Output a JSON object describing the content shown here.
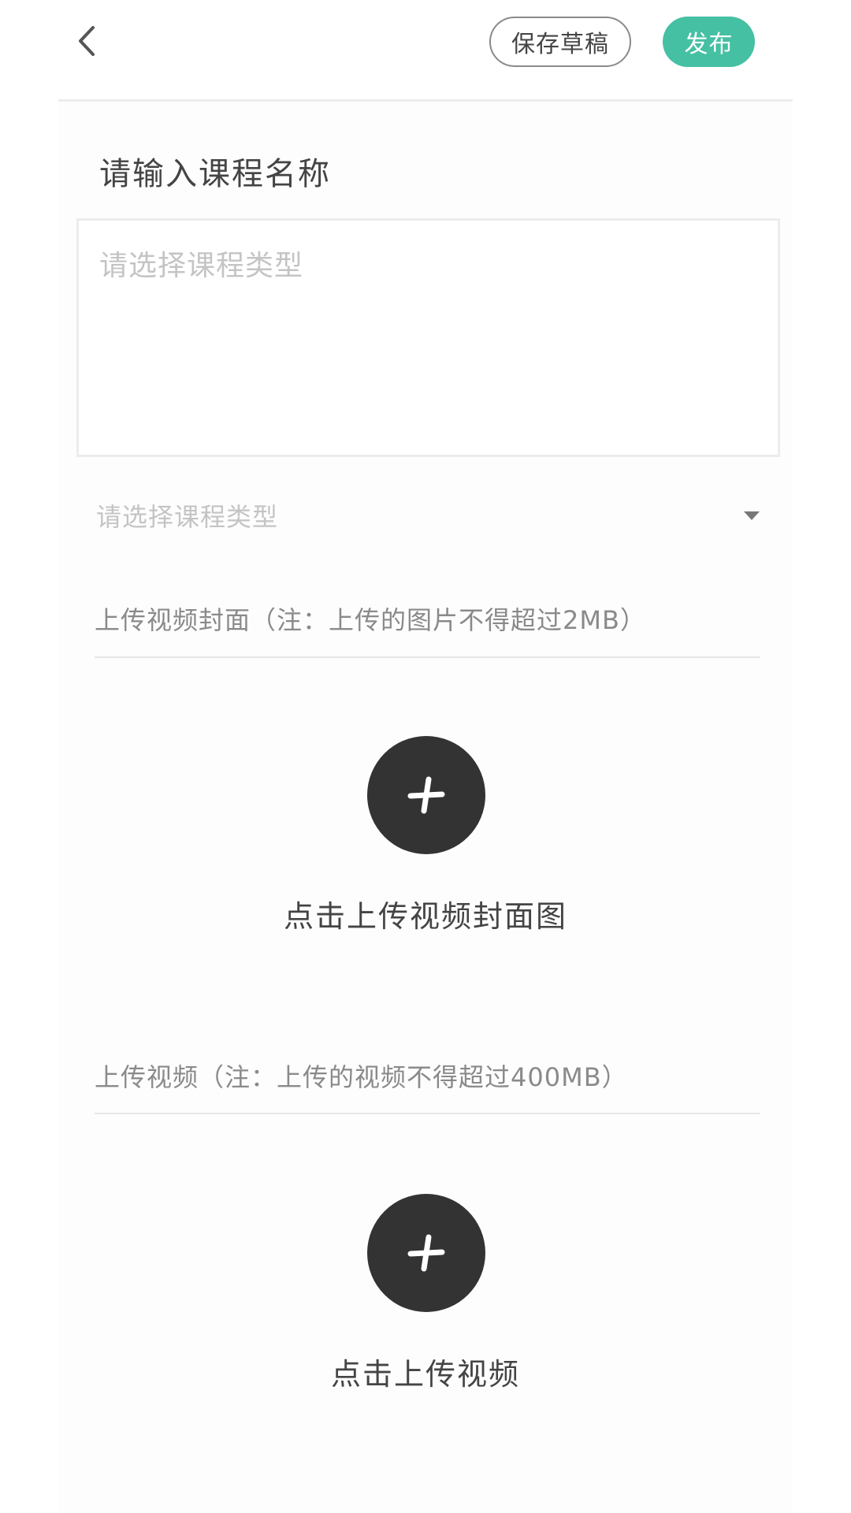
{
  "header": {
    "back_icon": "chevron-left-icon",
    "save_draft_label": "保存草稿",
    "publish_label": "发布",
    "accent_color": "#45c0a3"
  },
  "form": {
    "course_name_placeholder": "请输入课程名称",
    "description_placeholder": "请选择课程类型",
    "course_type_placeholder": "请选择课程类型",
    "course_type_icon": "caret-down-icon"
  },
  "cover_section": {
    "label": "上传视频封面（注：上传的图片不得超过2MB）",
    "upload_icon": "plus-icon",
    "caption": "点击上传视频封面图"
  },
  "video_section": {
    "label": "上传视频（注：上传的视频不得超过400MB）",
    "upload_icon": "plus-icon",
    "caption": "点击上传视频"
  }
}
